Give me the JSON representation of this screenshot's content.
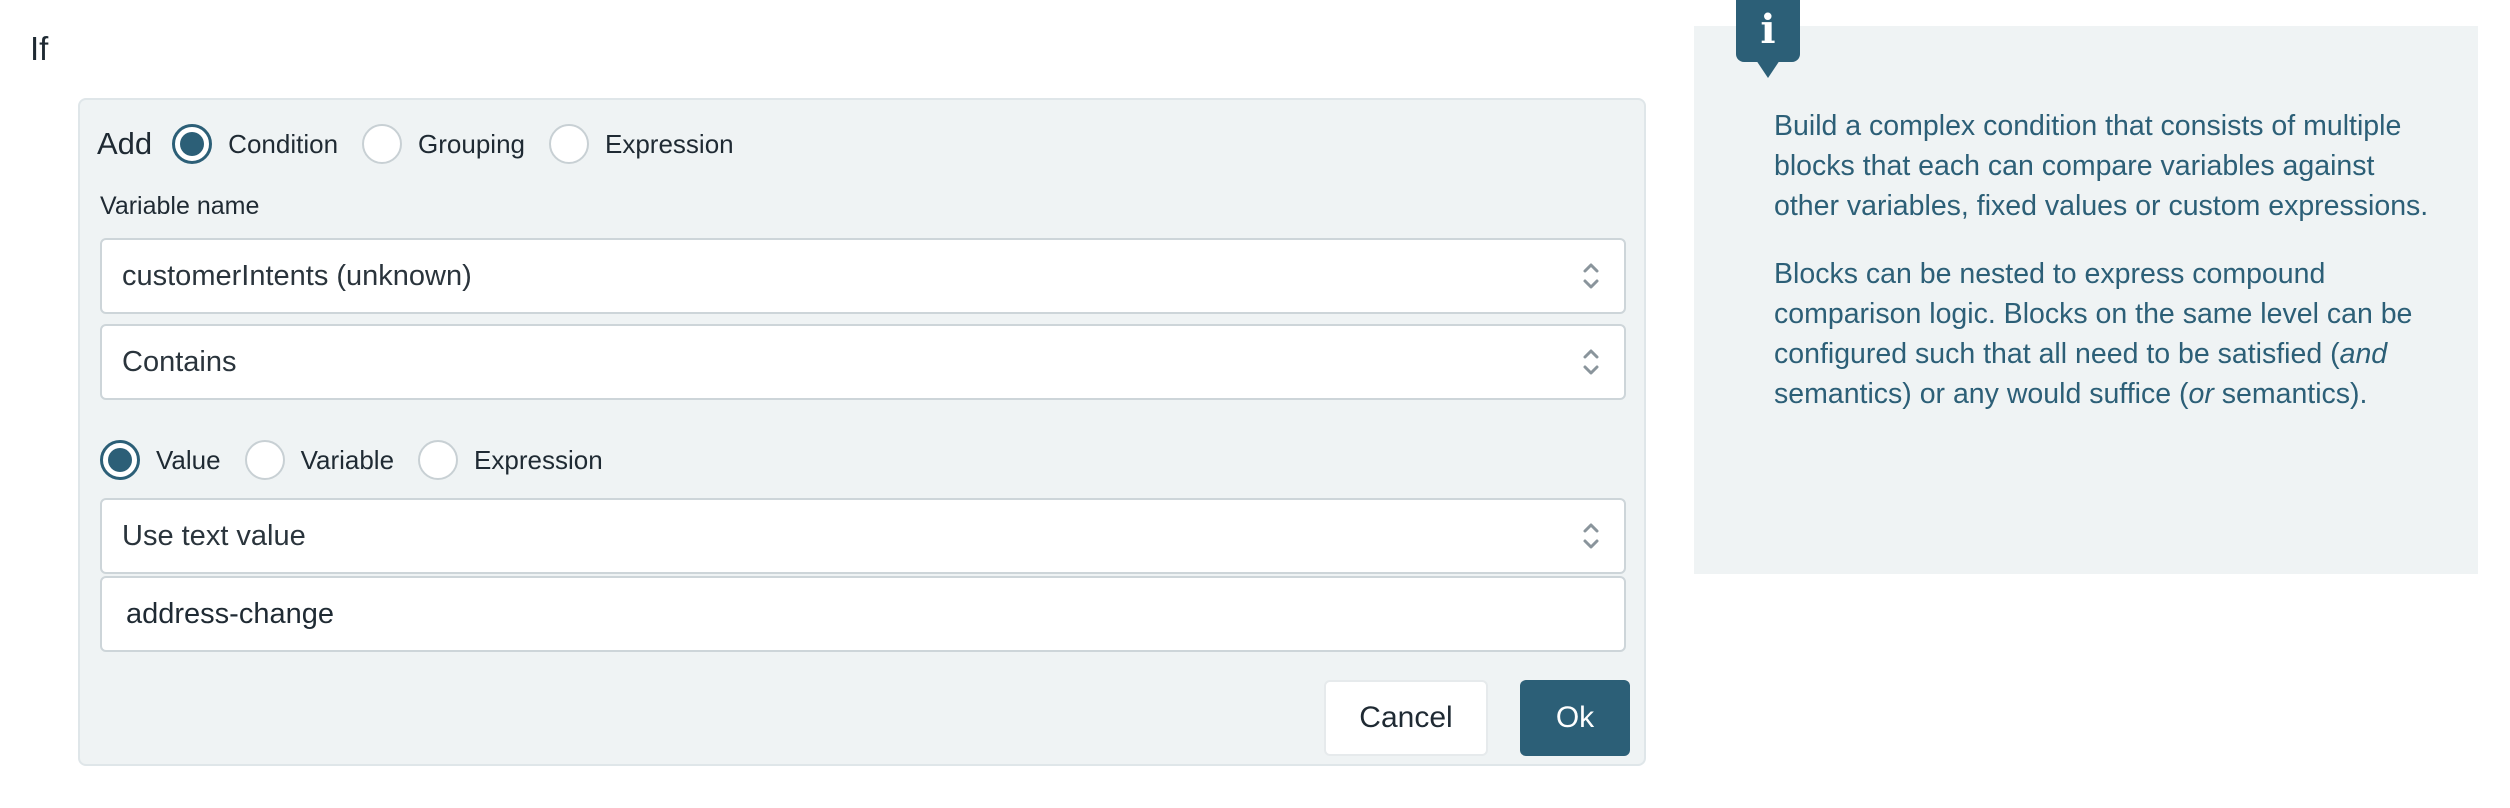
{
  "header": {
    "title": "If"
  },
  "add_row": {
    "label": "Add",
    "options": [
      {
        "label": "Condition",
        "checked": true
      },
      {
        "label": "Grouping",
        "checked": false
      },
      {
        "label": "Expression",
        "checked": false
      }
    ]
  },
  "variable": {
    "label": "Variable name",
    "selected": "customerIntents (unknown)"
  },
  "operator": {
    "selected": "Contains"
  },
  "compare_with": {
    "options": [
      {
        "label": "Value",
        "checked": true
      },
      {
        "label": "Variable",
        "checked": false
      },
      {
        "label": "Expression",
        "checked": false
      }
    ]
  },
  "value_type": {
    "selected": "Use text value"
  },
  "value_input": {
    "value": "address-change"
  },
  "buttons": {
    "cancel": "Cancel",
    "ok": "Ok"
  },
  "info": {
    "icon": "info-icon",
    "paragraph1": "Build a complex condition that consists of multiple blocks that each can compare variables against other variables, fixed values or custom expressions.",
    "paragraph2_a": "Blocks can be nested to express compound comparison logic. Blocks on the same level can be configured such that all need to be satisfied (",
    "paragraph2_and": "and",
    "paragraph2_b": " semantics) or any would suffice (",
    "paragraph2_or": "or",
    "paragraph2_c": " semantics)."
  },
  "colors": {
    "accent": "#2c5f77",
    "panel_bg": "#eff3f4",
    "border": "#cdd5d9"
  }
}
